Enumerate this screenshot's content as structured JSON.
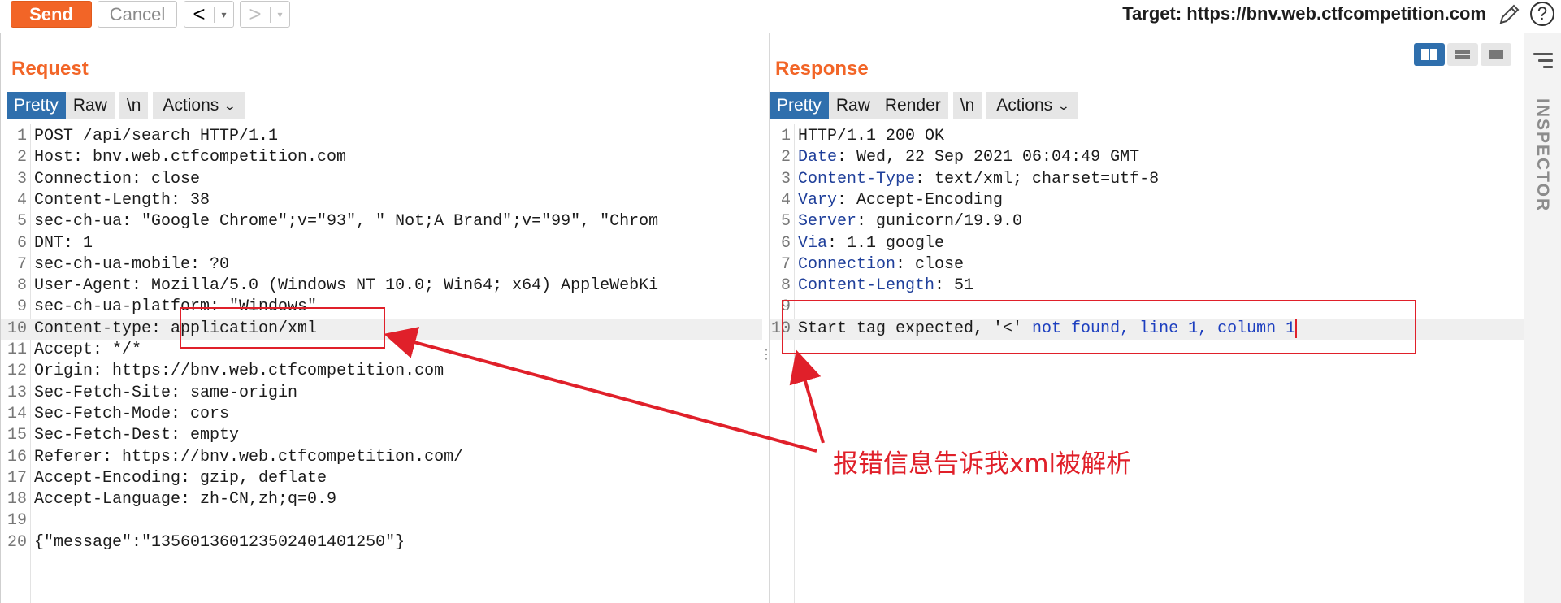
{
  "toolbar": {
    "send_label": "Send",
    "cancel_label": "Cancel",
    "back_label": "<",
    "forward_label": ">",
    "dropdown_caret": "▾",
    "target_text": "Target: https://bnv.web.ctfcompetition.com",
    "help_label": "?"
  },
  "request": {
    "title": "Request",
    "tabs": [
      "Pretty",
      "Raw",
      "\\n",
      "Actions"
    ],
    "lines": [
      {
        "n": "1",
        "text": "POST /api/search HTTP/1.1"
      },
      {
        "n": "2",
        "text": "Host: bnv.web.ctfcompetition.com"
      },
      {
        "n": "3",
        "text": "Connection: close"
      },
      {
        "n": "4",
        "text": "Content-Length: 38"
      },
      {
        "n": "5",
        "text": "sec-ch-ua: \"Google Chrome\";v=\"93\", \" Not;A Brand\";v=\"99\", \"Chrom"
      },
      {
        "n": "6",
        "text": "DNT: 1"
      },
      {
        "n": "7",
        "text": "sec-ch-ua-mobile: ?0"
      },
      {
        "n": "8",
        "text": "User-Agent: Mozilla/5.0 (Windows NT 10.0; Win64; x64) AppleWebKi"
      },
      {
        "n": "9",
        "text": "sec-ch-ua-platform: \"Windows\""
      },
      {
        "n": "10",
        "text": "Content-type: application/xml"
      },
      {
        "n": "11",
        "text": "Accept: */*"
      },
      {
        "n": "12",
        "text": "Origin: https://bnv.web.ctfcompetition.com"
      },
      {
        "n": "13",
        "text": "Sec-Fetch-Site: same-origin"
      },
      {
        "n": "14",
        "text": "Sec-Fetch-Mode: cors"
      },
      {
        "n": "15",
        "text": "Sec-Fetch-Dest: empty"
      },
      {
        "n": "16",
        "text": "Referer: https://bnv.web.ctfcompetition.com/"
      },
      {
        "n": "17",
        "text": "Accept-Encoding: gzip, deflate"
      },
      {
        "n": "18",
        "text": "Accept-Language: zh-CN,zh;q=0.9"
      },
      {
        "n": "19",
        "text": ""
      },
      {
        "n": "20",
        "text": "{\"message\":\"135601360123502401401250\"}"
      }
    ]
  },
  "response": {
    "title": "Response",
    "tabs": [
      "Pretty",
      "Raw",
      "Render",
      "\\n",
      "Actions"
    ],
    "lines": [
      {
        "n": "1",
        "key": "",
        "value": "HTTP/1.1 200 OK"
      },
      {
        "n": "2",
        "key": "Date",
        "value": ": Wed, 22 Sep 2021 06:04:49 GMT"
      },
      {
        "n": "3",
        "key": "Content-Type",
        "value": ": text/xml; charset=utf-8"
      },
      {
        "n": "4",
        "key": "Vary",
        "value": ": Accept-Encoding"
      },
      {
        "n": "5",
        "key": "Server",
        "value": ": gunicorn/19.9.0"
      },
      {
        "n": "6",
        "key": "Via",
        "value": ": 1.1 google"
      },
      {
        "n": "7",
        "key": "Connection",
        "value": ": close"
      },
      {
        "n": "8",
        "key": "Content-Length",
        "value": ": 51"
      },
      {
        "n": "9",
        "key": "",
        "value": ""
      },
      {
        "n": "10",
        "key": "",
        "value": ""
      }
    ],
    "body_line": {
      "part1": "Start tag expected, '<' ",
      "part2": "not found, line 1, column ",
      "part3": "1"
    }
  },
  "inspector": {
    "label": "INSPECTOR"
  },
  "annotation": {
    "text": "报错信息告诉我xml被解析"
  },
  "colors": {
    "accent": "#f26527",
    "tab_active": "#2f6fad",
    "annotation": "#e0202a"
  }
}
